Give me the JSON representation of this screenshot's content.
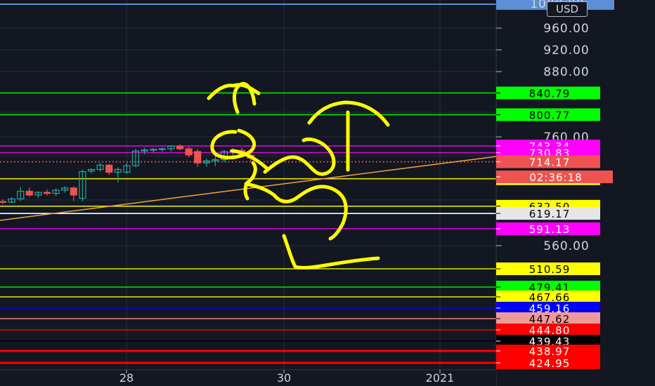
{
  "currency": "USD",
  "colors": {
    "background": "#131722",
    "grid": "#2a2e39",
    "up": "#26a69a",
    "down": "#ef5350",
    "trendline": "#f7a13c",
    "drawing": "#ffff00"
  },
  "chart_data": {
    "type": "candlestick",
    "y_axis_labels": [
      "960.00",
      "920.00",
      "880.00",
      "760.00",
      "560.00"
    ],
    "partially_hidden_labels": [
      "1000.00"
    ],
    "x_axis_labels": [
      "28",
      "30",
      "2021"
    ],
    "candles": [
      {
        "o": 641,
        "h": 645,
        "l": 636,
        "c": 640
      },
      {
        "o": 640,
        "h": 649,
        "l": 638,
        "c": 646
      },
      {
        "o": 646,
        "h": 668,
        "l": 642,
        "c": 660
      },
      {
        "o": 660,
        "h": 667,
        "l": 650,
        "c": 653
      },
      {
        "o": 653,
        "h": 660,
        "l": 648,
        "c": 658
      },
      {
        "o": 658,
        "h": 663,
        "l": 652,
        "c": 656
      },
      {
        "o": 656,
        "h": 665,
        "l": 651,
        "c": 662
      },
      {
        "o": 662,
        "h": 669,
        "l": 657,
        "c": 666
      },
      {
        "o": 666,
        "h": 669,
        "l": 642,
        "c": 653
      },
      {
        "o": 647,
        "h": 700,
        "l": 642,
        "c": 696
      },
      {
        "o": 697,
        "h": 702,
        "l": 693,
        "c": 700
      },
      {
        "o": 700,
        "h": 712,
        "l": 696,
        "c": 708
      },
      {
        "o": 708,
        "h": 710,
        "l": 690,
        "c": 695
      },
      {
        "o": 695,
        "h": 704,
        "l": 676,
        "c": 700
      },
      {
        "o": 695,
        "h": 712,
        "l": 692,
        "c": 707
      },
      {
        "o": 707,
        "h": 738,
        "l": 704,
        "c": 734
      },
      {
        "o": 734,
        "h": 740,
        "l": 728,
        "c": 736
      },
      {
        "o": 736,
        "h": 739,
        "l": 731,
        "c": 737
      },
      {
        "o": 737,
        "h": 741,
        "l": 733,
        "c": 738
      },
      {
        "o": 738,
        "h": 744,
        "l": 733,
        "c": 743
      },
      {
        "o": 743,
        "h": 746,
        "l": 735,
        "c": 738
      },
      {
        "o": 738,
        "h": 742,
        "l": 722,
        "c": 727
      },
      {
        "o": 733,
        "h": 738,
        "l": 705,
        "c": 712
      },
      {
        "o": 712,
        "h": 720,
        "l": 705,
        "c": 716
      },
      {
        "o": 716,
        "h": 726,
        "l": 706,
        "c": 718
      },
      {
        "o": 718,
        "h": 736,
        "l": 714,
        "c": 733
      },
      {
        "o": 733,
        "h": 739,
        "l": 722,
        "c": 735
      },
      {
        "o": 735,
        "h": 740,
        "l": 722,
        "c": 726
      },
      {
        "o": 726,
        "h": 730,
        "l": 716,
        "c": 721
      }
    ],
    "horizontal_levels": [
      {
        "value": "840.79",
        "line": "#00e600",
        "tag_bg": "#00ff00",
        "tag_fg": "#000000"
      },
      {
        "value": "800.77",
        "line": "#00e600",
        "tag_bg": "#00ff00",
        "tag_fg": "#000000"
      },
      {
        "value": "743.34",
        "line": "#e000e0",
        "tag_bg": "#ff00ff",
        "tag_fg": "#ffffff"
      },
      {
        "value": "730.83",
        "line": "#e000e0",
        "tag_bg": "#ff00ff",
        "tag_fg": "#ffffff"
      },
      {
        "value": "714.17",
        "line": "#ef5350",
        "tag_bg": "#ef5350",
        "tag_fg": "#ffffff",
        "dotted": true
      },
      {
        "value": "683.03",
        "line": "#e6e600",
        "tag_bg": "#ffff00",
        "tag_fg": "#000000"
      },
      {
        "value": "632.50",
        "line": "#e6e600",
        "tag_bg": "#ffff00",
        "tag_fg": "#000000"
      },
      {
        "value": "619.17",
        "line": "#ffffff",
        "tag_bg": "#e6e6e6",
        "tag_fg": "#000000"
      },
      {
        "value": "591.13",
        "line": "#e000e0",
        "tag_bg": "#ff00ff",
        "tag_fg": "#ffffff"
      },
      {
        "value": "510.59",
        "line": "#e6e600",
        "tag_bg": "#ffff00",
        "tag_fg": "#000000"
      },
      {
        "value": "479.41",
        "line": "#00e600",
        "tag_bg": "#00ff00",
        "tag_fg": "#000000"
      },
      {
        "value": "467.66",
        "line": "#e6e600",
        "tag_bg": "#ffff00",
        "tag_fg": "#000000"
      },
      {
        "value": "459.16",
        "line": "#0000ff",
        "tag_bg": "#0000ff",
        "tag_fg": "#ffffff"
      },
      {
        "value": "447.62",
        "line": "#ef8080",
        "tag_bg": "#ef9a9a",
        "tag_fg": "#000000"
      },
      {
        "value": "444.80",
        "line": "#ff0000",
        "tag_bg": "#ff0000",
        "tag_fg": "#ffffff"
      },
      {
        "value": "439.43",
        "line": "#000000",
        "tag_bg": "#000000",
        "tag_fg": "#ffffff"
      },
      {
        "value": "438.97",
        "line": "#ff0000",
        "tag_bg": "#ff0000",
        "tag_fg": "#ffffff"
      },
      {
        "value": "424.95",
        "line": "#ff0000",
        "tag_bg": "#ff0000",
        "tag_fg": "#ffffff"
      }
    ],
    "countdown": {
      "text": "02:36:18",
      "bg": "#ef5350",
      "fg": "#ffffff"
    },
    "trendline": {
      "color": "#f7a13c"
    },
    "hand_drawing": {
      "color": "#ffff00"
    }
  }
}
